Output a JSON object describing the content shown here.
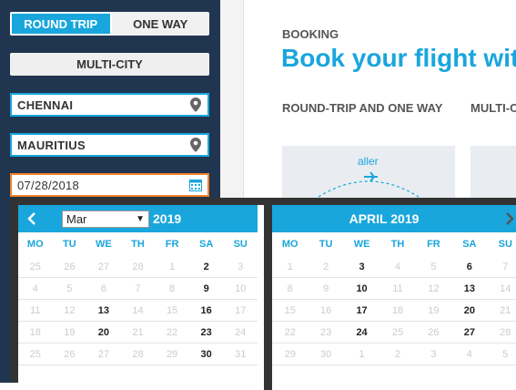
{
  "sidebar": {
    "trip_types": [
      {
        "label": "ROUND TRIP",
        "active": true
      },
      {
        "label": "ONE WAY",
        "active": false
      }
    ],
    "multi_city_label": "MULTI-CITY",
    "from": {
      "value": "CHENNAI",
      "icon": "map-pin-icon"
    },
    "to": {
      "value": "MAURITIUS",
      "icon": "map-pin-icon"
    },
    "date": {
      "value": "07/28/2018",
      "icon": "calendar-icon"
    }
  },
  "main": {
    "section_label": "BOOKING",
    "headline": "Book your flight with",
    "tabs": [
      "ROUND-TRIP AND ONE WAY",
      "MULTI-CITY"
    ],
    "card_label": "aller"
  },
  "calendar": {
    "left": {
      "selected_month": "Mar",
      "year": "2019",
      "prev_icon": "chevron-left-icon"
    },
    "right": {
      "title": "APRIL 2019",
      "next_icon": "chevron-right-icon"
    },
    "weekdays": [
      "MO",
      "TU",
      "WE",
      "TH",
      "FR",
      "SA",
      "SU"
    ],
    "left_days": [
      [
        "25",
        "d"
      ],
      [
        "26",
        "d"
      ],
      [
        "27",
        "d"
      ],
      [
        "28",
        "d"
      ],
      [
        "1",
        "d"
      ],
      [
        "2",
        "e"
      ],
      [
        "3",
        "d"
      ],
      [
        "4",
        "d"
      ],
      [
        "5",
        "d"
      ],
      [
        "6",
        "d"
      ],
      [
        "7",
        "d"
      ],
      [
        "8",
        "d"
      ],
      [
        "9",
        "e"
      ],
      [
        "10",
        "d"
      ],
      [
        "11",
        "d"
      ],
      [
        "12",
        "d"
      ],
      [
        "13",
        "e"
      ],
      [
        "14",
        "d"
      ],
      [
        "15",
        "d"
      ],
      [
        "16",
        "e"
      ],
      [
        "17",
        "d"
      ],
      [
        "18",
        "d"
      ],
      [
        "19",
        "d"
      ],
      [
        "20",
        "e"
      ],
      [
        "21",
        "d"
      ],
      [
        "22",
        "d"
      ],
      [
        "23",
        "e"
      ],
      [
        "24",
        "d"
      ],
      [
        "25",
        "d"
      ],
      [
        "26",
        "d"
      ],
      [
        "27",
        "d"
      ],
      [
        "28",
        "d"
      ],
      [
        "29",
        "d"
      ],
      [
        "30",
        "e"
      ],
      [
        "31",
        "d"
      ]
    ],
    "right_days": [
      [
        "1",
        "d"
      ],
      [
        "2",
        "d"
      ],
      [
        "3",
        "e"
      ],
      [
        "4",
        "d"
      ],
      [
        "5",
        "d"
      ],
      [
        "6",
        "e"
      ],
      [
        "7",
        "d"
      ],
      [
        "8",
        "d"
      ],
      [
        "9",
        "d"
      ],
      [
        "10",
        "e"
      ],
      [
        "11",
        "d"
      ],
      [
        "12",
        "d"
      ],
      [
        "13",
        "e"
      ],
      [
        "14",
        "d"
      ],
      [
        "15",
        "d"
      ],
      [
        "16",
        "d"
      ],
      [
        "17",
        "e"
      ],
      [
        "18",
        "d"
      ],
      [
        "19",
        "d"
      ],
      [
        "20",
        "e"
      ],
      [
        "21",
        "d"
      ],
      [
        "22",
        "d"
      ],
      [
        "23",
        "d"
      ],
      [
        "24",
        "e"
      ],
      [
        "25",
        "d"
      ],
      [
        "26",
        "d"
      ],
      [
        "27",
        "e"
      ],
      [
        "28",
        "d"
      ],
      [
        "29",
        "d"
      ],
      [
        "30",
        "d"
      ],
      [
        "1",
        "d"
      ],
      [
        "2",
        "d"
      ],
      [
        "3",
        "d"
      ],
      [
        "4",
        "d"
      ],
      [
        "5",
        "d"
      ]
    ],
    "colors": {
      "accent": "#19a6dc",
      "panel": "#20354f",
      "date_border": "#f0822c"
    }
  }
}
